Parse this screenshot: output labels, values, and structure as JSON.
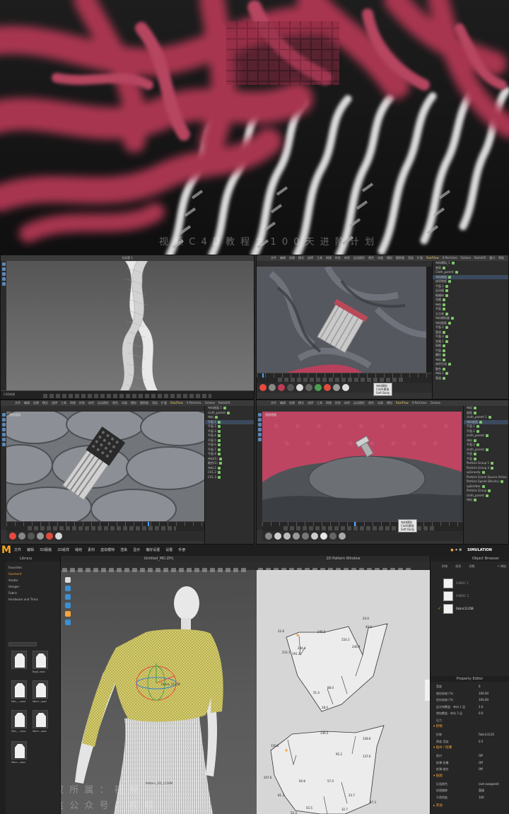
{
  "hero": {
    "watermark": "视 频 C 4 D 教 程 之 1 0 0 天 进 阶 计 划"
  },
  "c4d": {
    "pane_tl": {
      "title": "无标题 1",
      "bottom_text": "C4D材质"
    },
    "pane_tr": {
      "menu": [
        "文件",
        "编辑",
        "创建",
        "模式",
        "选择",
        "工具",
        "网格",
        "样条",
        "体积",
        "运动图形",
        "角色",
        "动画",
        "模拟",
        "跟踪器",
        "渲染",
        "扩展",
        "RealFlow",
        "X-Particles",
        "Octane",
        "Redshift",
        "窗口",
        "帮助"
      ],
      "menu_highlight": "RealFlow",
      "tooltip": [
        "布料模拟",
        "Cloth模拟",
        "Soft Body"
      ],
      "objects": [
        "布料模拟_1",
        "曲面",
        "Cloth_parent",
        "布料曲面",
        "体积转换",
        "平面.1",
        "运动器",
        "碰撞体",
        "克隆",
        "布料",
        "平面",
        "立方体",
        "布料模拟器",
        "布料曲面",
        "平面.2",
        "管道",
        "平面.3",
        "克隆.1",
        "网格",
        "平面",
        "圆柱",
        "布料",
        "体积生成",
        "融合",
        "布料.1",
        "管道"
      ],
      "frames": "0 F"
    },
    "pane_bl": {
      "view_label": "透视视图",
      "objects": [
        "布料曲面.1",
        "cloth_parent",
        "布料",
        "平面.1",
        "平面.2",
        "平面.3",
        "平面.4",
        "平面.5",
        "平面.6",
        "平面.7",
        "平面.8",
        "布料(1)",
        "融合(1)",
        "布料.2",
        "CX1.2",
        "CX1.3"
      ],
      "frames": "0 F"
    },
    "pane_br": {
      "view_label": "透视视图",
      "objects": [
        "布料",
        "曲面",
        "cloth_parent 1",
        "布料曲面",
        "平面.1",
        "平面.2",
        "cloth_parent",
        "布料",
        "平面.3",
        "cloth_parent",
        "平面",
        "平面",
        "Particle Group 1",
        "Particle Group 4",
        "xpGravity",
        "Particle Scene Source Action",
        "Particle Speed (Blocks)",
        "xpEmitter",
        "Particle Group",
        "cloth_parent",
        "布料"
      ],
      "tooltip": [
        "布料模拟",
        "Cloth模拟",
        "Soft Body"
      ],
      "frames": "0 F"
    }
  },
  "md": {
    "logo": "M",
    "menu": [
      "文件",
      "编辑",
      "3D服装",
      "2D纸样",
      "缝纫",
      "素材",
      "虚拟模特",
      "渲染",
      "显示",
      "偏好设置",
      "设置",
      "手册"
    ],
    "simulation": "SIMULATION",
    "library": {
      "title": "Library",
      "items": [
        "Favorites",
        "Garment",
        "Avatar",
        "Hanger",
        "Fabric",
        "Hardware and Trims"
      ],
      "thumbs": [
        "",
        "Bag1.zpac",
        "Men_...zpac",
        "Wom...zpac",
        "Men_...zpac",
        "Wom...zpac",
        "Wom...zpac"
      ]
    },
    "view3d": {
      "title": "Untitled_MD.ZPrj",
      "label_pattern": "Fabric_1135B",
      "label_skirt": "Pattern_GD_1156M"
    },
    "view2d": {
      "title": "2D Pattern Window",
      "top_measure": [
        "245.5",
        "40.6",
        "154.3",
        "191.3",
        "244.4",
        "246.9",
        "88.0",
        "51.4",
        "28.0",
        "233.1",
        "22.8",
        "24.0"
      ],
      "bottom_measure": [
        "136.5",
        "95.2",
        "150.6",
        "137.6",
        "207.6",
        "60.8",
        "23.7",
        "55.5",
        "52.3",
        "128.6",
        "57.0",
        "87.3",
        "81.3",
        "32.7"
      ]
    },
    "object_browser": {
      "title": "Object Browser",
      "tabs": [
        "织物",
        "纽扣",
        "扣眼"
      ],
      "add_label": "+ 增加",
      "fabrics": [
        "FABRIC 1",
        "FABRIC 2",
        "Fabric1135B"
      ]
    },
    "property_editor": {
      "title": "Property Editor",
      "rows": [
        {
          "label": "宽度",
          "value": "0"
        },
        {
          "label": "缩短收缩 (%)",
          "value": "100.00"
        },
        {
          "label": "经向收缩 (%)",
          "value": "100.00"
        },
        {
          "label": "层次和覆盖 - 单向 1 层",
          "value": "2.0"
        },
        {
          "label": "增加覆盖 - 单向 3 层",
          "value": "0.0"
        },
        {
          "label": "压力",
          "value": ""
        }
      ],
      "sections": [
        "织物",
        "粘衬 / 削薄",
        "贴图"
      ],
      "fabric_rows": [
        {
          "label": "织物",
          "value": "Fabric1135"
        },
        {
          "label": "厚度-渲染",
          "value": "0.5"
        }
      ],
      "fuse_rows": [
        {
          "label": "粘衬",
          "value": "Off"
        },
        {
          "label": "削薄-折叠",
          "value": "Off"
        },
        {
          "label": "削薄-缝合",
          "value": "Off"
        }
      ],
      "tex_rows": [
        {
          "label": "反面颜色",
          "value": "(not assigned)"
        },
        {
          "label": "纹理偏移",
          "value": "直接"
        },
        {
          "label": "不透明度",
          "value": "100"
        }
      ],
      "footer": "其他"
    },
    "watermark_lines": [
      "版 权 所 属 ： 视 频",
      "微 信 公 众 号 ： 视 频"
    ]
  },
  "colors": {
    "crimson": "#a8344f",
    "md_accent": "#f3a43a",
    "c4d_select": "#3b4a5e"
  }
}
